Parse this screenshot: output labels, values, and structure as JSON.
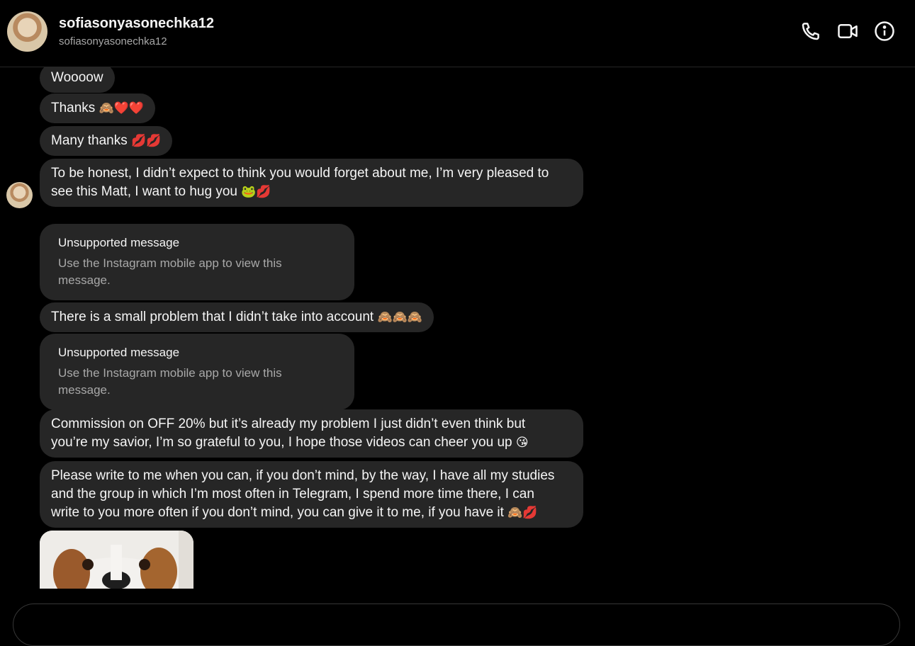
{
  "header": {
    "name": "sofiasonyasonechka12",
    "handle": "sofiasonyasonechka12",
    "icons": [
      "phone-icon",
      "video-camera-icon",
      "info-icon"
    ]
  },
  "messages": [
    {
      "type": "text",
      "text": "Woooow",
      "emoji": ""
    },
    {
      "type": "text",
      "text": "Thanks ",
      "emoji": "🙈❤️❤️"
    },
    {
      "type": "text",
      "text": "Many thanks ",
      "emoji": "💋💋"
    },
    {
      "type": "text",
      "text_line1": "To be honest, I didn’t expect to think you would forget about me, I’m very pleased to",
      "text_line2": "see this Matt, I want to hug you ",
      "emoji": "🐸💋"
    },
    {
      "type": "unsupported",
      "title": "Unsupported message",
      "body": "Use the Instagram mobile app to view this message."
    },
    {
      "type": "text",
      "text": "There is a small problem that I didn’t take into account ",
      "emoji": "🙈🙈🙈"
    },
    {
      "type": "unsupported",
      "title": "Unsupported message",
      "body": "Use the Instagram mobile app to view this message."
    },
    {
      "type": "text",
      "text_line1": "Commission on OFF 20% but it’s already my problem I just didn’t even think but",
      "text_line2": "you’re my savior, I’m so grateful to you, I hope those videos can cheer you up ",
      "emoji": "😘"
    },
    {
      "type": "text",
      "text_line1": "Please write to me when you can, if you don’t mind, by the way, I have all my studies",
      "text_line2": "and the group in which I’m most often in Telegram, I spend more time there, I can",
      "text_line3": "write to you more often if you don’t mind, you can give it to me, if you have it ",
      "emoji": "🙈💋"
    },
    {
      "type": "image",
      "alt_icon": "dog-photo"
    }
  ],
  "colors": {
    "background": "#000000",
    "bubble": "#262626",
    "secondary_text": "#a8a8a8"
  }
}
